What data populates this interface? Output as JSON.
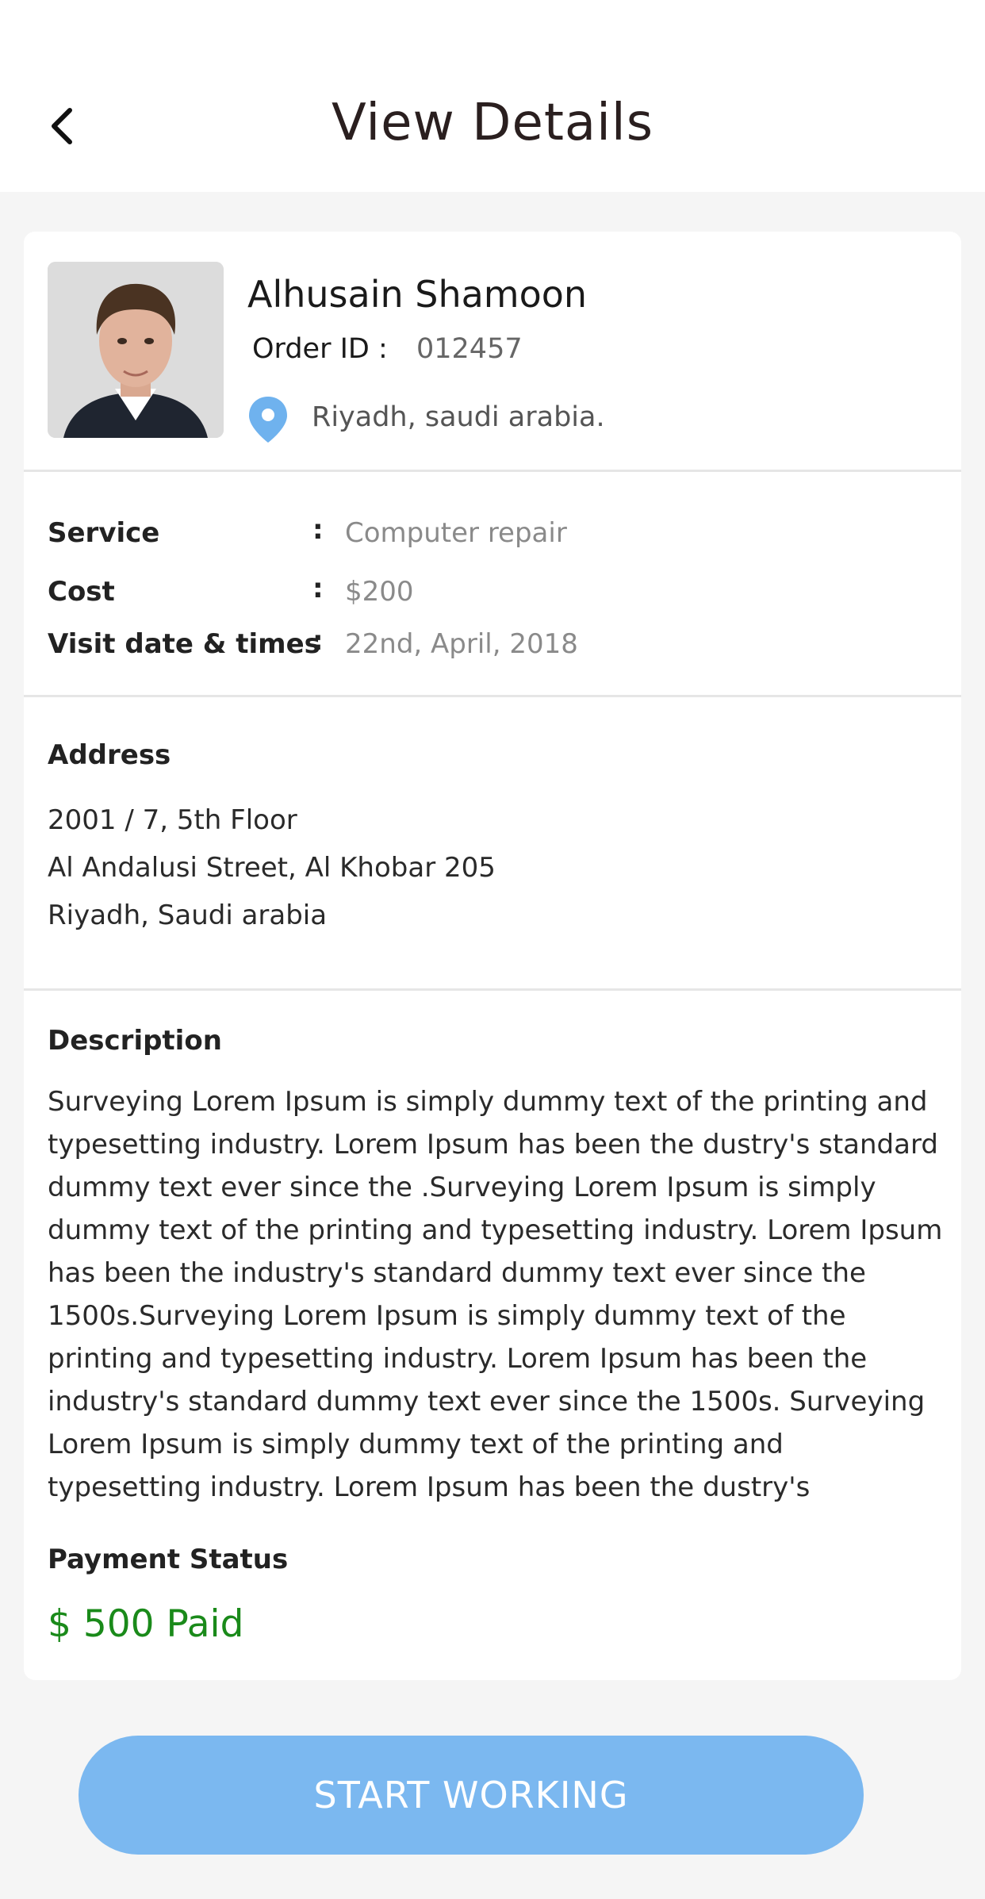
{
  "header": {
    "title": "View Details"
  },
  "profile": {
    "name": "Alhusain Shamoon",
    "order_id_label": "Order ID :",
    "order_id_value": "012457",
    "location": "Riyadh, saudi arabia."
  },
  "info": [
    {
      "label": "Service",
      "colon": ":",
      "value": "Computer repair"
    },
    {
      "label": "Cost",
      "colon": ":",
      "value": "$200"
    },
    {
      "label": "Visit date & times",
      "colon": ":",
      "value": "22nd, April, 2018"
    }
  ],
  "address": {
    "heading": "Address",
    "lines": [
      "2001 / 7, 5th Floor",
      "Al Andalusi Street, Al Khobar 205",
      "Riyadh, Saudi arabia"
    ]
  },
  "description": {
    "heading": "Description",
    "text": "Surveying Lorem Ipsum is simply dummy text of the printing and typesetting industry. Lorem Ipsum has been the dustry's standard dummy text ever since the .Surveying Lorem Ipsum is simply dummy text of the printing and typesetting industry. Lorem Ipsum has been the industry's standard dummy text ever since the 1500s.Surveying Lorem Ipsum is simply dummy text of the printing and typesetting industry. Lorem Ipsum has been the industry's standard dummy text ever since the 1500s. Surveying Lorem Ipsum is simply dummy text of the printing and typesetting industry. Lorem Ipsum has been the dustry's"
  },
  "payment": {
    "heading": "Payment Status",
    "value": "$ 500 Paid"
  },
  "action": {
    "label": "START WORKING"
  },
  "icons": {
    "back": "chevron-left-icon",
    "pin": "map-pin-icon"
  },
  "colors": {
    "accent": "#7bb8f0",
    "paid": "#1a8a1a",
    "pin": "#6fb2ee"
  }
}
